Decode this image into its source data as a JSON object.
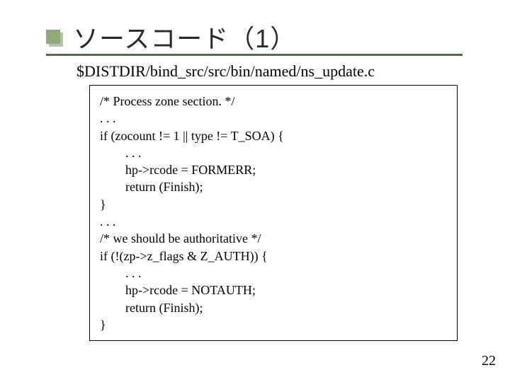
{
  "title": "ソースコード（1）",
  "file_path": "$DISTDIR/bind_src/src/bin/named/ns_update.c",
  "code": "/* Process zone section. */\n. . .\nif (zocount != 1 || type != T_SOA) {\n        . . .\n        hp->rcode = FORMERR;\n        return (Finish);\n}\n. . .\n/* we should be authoritative */\nif (!(zp->z_flags & Z_AUTH)) {\n        . . .\n        hp->rcode = NOTAUTH;\n        return (Finish);\n}",
  "page_number": "22"
}
